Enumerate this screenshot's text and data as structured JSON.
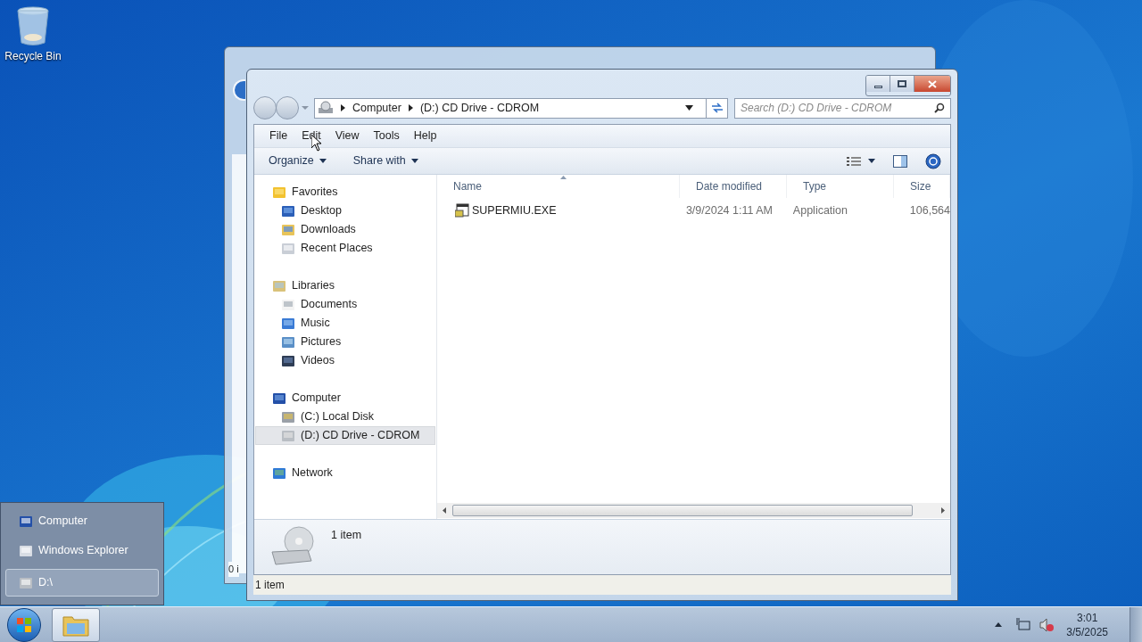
{
  "desktop_icons": [
    {
      "label": "Recycle Bin"
    }
  ],
  "background_window": {
    "status_bar": "0 i"
  },
  "window": {
    "address": {
      "crumbs": [
        "Computer",
        "(D:) CD Drive - CDROM"
      ]
    },
    "search": {
      "placeholder": "Search (D:) CD Drive - CDROM"
    },
    "menu": [
      "File",
      "Edit",
      "View",
      "Tools",
      "Help"
    ],
    "toolbar": [
      "Organize",
      "Share with"
    ],
    "nav": [
      {
        "label": "Favorites",
        "selected": false,
        "children": [
          {
            "label": "Desktop",
            "selected": false
          },
          {
            "label": "Downloads",
            "selected": false
          },
          {
            "label": "Recent Places",
            "selected": false
          }
        ]
      },
      {
        "label": "Libraries",
        "selected": false,
        "children": [
          {
            "label": "Documents",
            "selected": false
          },
          {
            "label": "Music",
            "selected": false
          },
          {
            "label": "Pictures",
            "selected": false
          },
          {
            "label": "Videos",
            "selected": false
          }
        ]
      },
      {
        "label": "Computer",
        "selected": false,
        "children": [
          {
            "label": "(C:) Local Disk",
            "selected": false
          },
          {
            "label": "(D:) CD Drive - CDROM",
            "selected": true
          }
        ]
      },
      {
        "label": "Network",
        "selected": false
      }
    ],
    "columns": [
      "Name",
      "Date modified",
      "Type",
      "Size"
    ],
    "rows": [
      {
        "name": "SUPERMIU.EXE",
        "date": "3/9/2024 1:11 AM",
        "type": "Application",
        "size": "106,564"
      }
    ],
    "details": {
      "count": "1 item"
    },
    "status_bar": "1 item"
  },
  "jump_list": [
    {
      "label": "Computer",
      "selected": false
    },
    {
      "label": "Windows Explorer",
      "selected": false
    },
    {
      "label": "D:\\",
      "selected": true
    }
  ],
  "tray": {
    "time": "3:01",
    "date": "3/5/2025"
  }
}
